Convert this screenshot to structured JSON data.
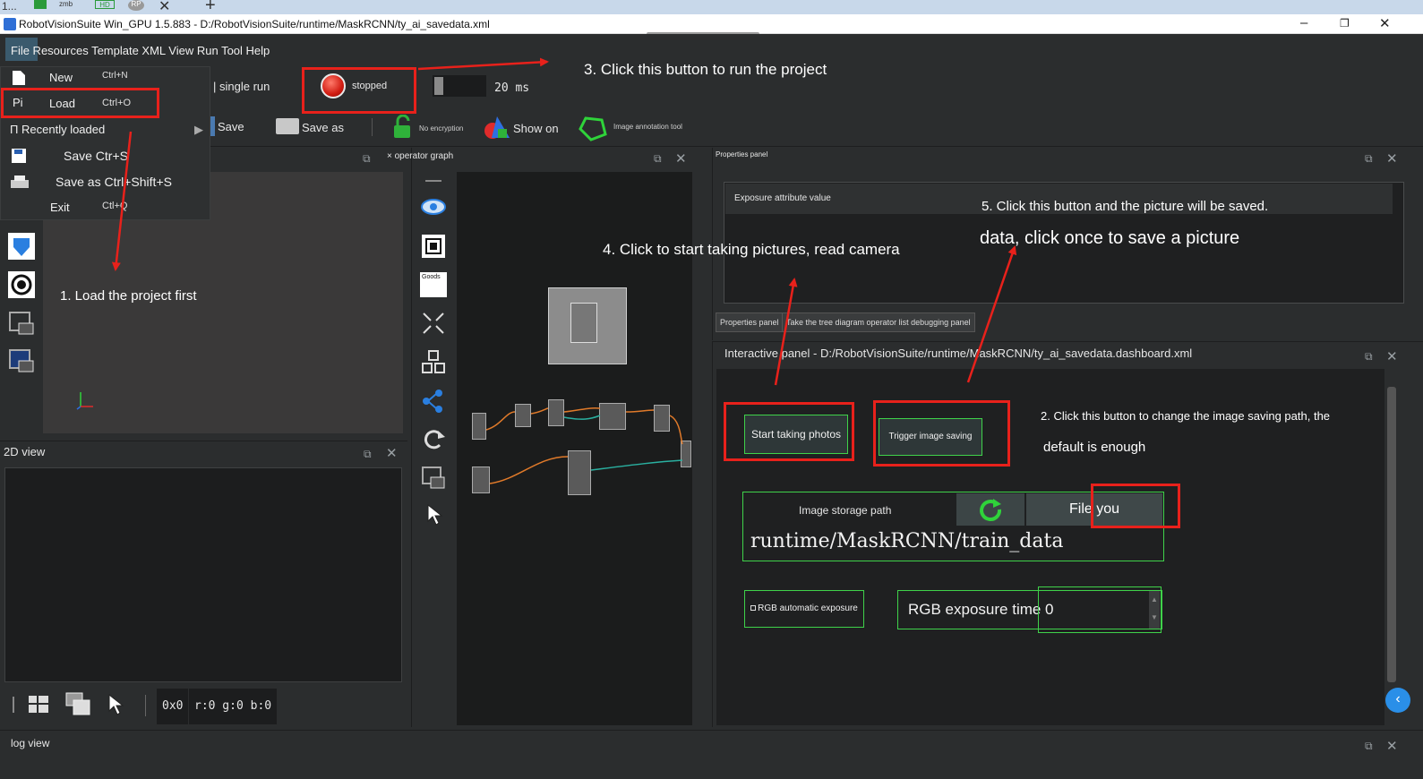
{
  "browser": {
    "fragment_left": "1...",
    "tab_small": "zmb",
    "close_glyph": "✕",
    "newtab_glyph": "+"
  },
  "window": {
    "title": "RobotVisionSuite Win_GPU 1.5.883 - D:/RobotVisionSuite/runtime/MaskRCNN/ty_ai_savedata.xml"
  },
  "menu": {
    "items_text": "File Resources Template XML View Run Tool Help"
  },
  "file_menu": {
    "new_label": "New",
    "new_shortcut": "Ctrl+N",
    "load_prefix": "Pi",
    "load_label": "Load",
    "load_shortcut": "Ctrl+O",
    "recent_label": "Π Recently loaded",
    "save_label": "Save Ctr+S",
    "save_as_label": "Save as Ctrl+Shift+S",
    "exit_label": "Exit",
    "exit_shortcut": "Ctl+Q"
  },
  "toolbar": {
    "single_run": "| single run",
    "run_status": "stopped",
    "cycle_time": "20 ms",
    "save": "Save",
    "save_as": "Save as",
    "no_encryption": "No encryption",
    "show_on": "Show on",
    "image_annotation": "Image annotation tool"
  },
  "panels": {
    "operator_graph": "× operator graph",
    "view_2d": "2D view",
    "properties": "Properties panel",
    "exposure_attr": "Exposure attribute value",
    "tab_properties": "Properties panel",
    "tab_tree": "Take the tree diagram operator list debugging panel",
    "interactive": "Interactive panel - D:/RobotVisionSuite/runtime/MaskRCNN/ty_ai_savedata.dashboard.xml",
    "log": "log view",
    "readout_size": "0x0",
    "readout_rgb": "r:0 g:0 b:0",
    "goods_label": "Goods"
  },
  "dashboard": {
    "start_taking_photos": "Start taking photos",
    "trigger_image_saving": "Trigger image saving",
    "image_storage_path_label": "Image storage path",
    "file_button": "File you",
    "storage_path_value": "runtime/MaskRCNN/train_data",
    "rgb_auto_exposure": "RGB automatic exposure",
    "rgb_exposure_time": "RGB exposure time 0"
  },
  "annotations": {
    "step1": "1. Load the project first",
    "step2_line1": "2. Click this button to change the image saving path, the",
    "step2_line2": "default is enough",
    "step3": "3. Click this button to run the project",
    "step4": "4. Click to start taking pictures, read camera",
    "step5_line1": "5. Click this button and the picture will be saved.",
    "step5_line2": "data, click once to save a picture"
  },
  "colors": {
    "highlight_red": "#e8211b",
    "widget_green": "#3fd24a",
    "panel_bg": "#2b2d2e"
  }
}
